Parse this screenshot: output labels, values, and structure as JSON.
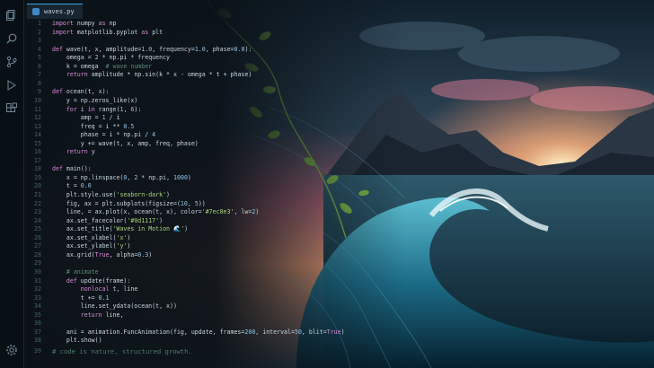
{
  "editor": {
    "tab_label": "waves.py",
    "lines": [
      {
        "n": "1",
        "text": "import numpy as np"
      },
      {
        "n": "2",
        "text": "import matplotlib.pyplot as plt"
      },
      {
        "n": "3",
        "text": ""
      },
      {
        "n": "4",
        "text": "def wave(t, x, amplitude=1.0, frequency=1.0, phase=0.0):"
      },
      {
        "n": "5",
        "text": "    omega = 2 * np.pi * frequency"
      },
      {
        "n": "6",
        "text": "    k = omega  # wave number"
      },
      {
        "n": "7",
        "text": "    return amplitude * np.sin(k * x - omega * t + phase)"
      },
      {
        "n": "8",
        "text": ""
      },
      {
        "n": "9",
        "text": "def ocean(t, x):"
      },
      {
        "n": "10",
        "text": "    y = np.zeros_like(x)"
      },
      {
        "n": "11",
        "text": "    for i in range(1, 6):"
      },
      {
        "n": "12",
        "text": "        amp = 1 / i"
      },
      {
        "n": "13",
        "text": "        freq = i ** 0.5"
      },
      {
        "n": "14",
        "text": "        phase = i * np.pi / 4"
      },
      {
        "n": "15",
        "text": "        y += wave(t, x, amp, freq, phase)"
      },
      {
        "n": "16",
        "text": "    return y"
      },
      {
        "n": "17",
        "text": ""
      },
      {
        "n": "18",
        "text": "def main():"
      },
      {
        "n": "19",
        "text": "    x = np.linspace(0, 2 * np.pi, 1000)"
      },
      {
        "n": "20",
        "text": "    t = 0.0"
      },
      {
        "n": "21",
        "text": "    plt.style.use('seaborn-dark')"
      },
      {
        "n": "22",
        "text": "    fig, ax = plt.subplots(figsize=(10, 5))"
      },
      {
        "n": "23",
        "text": "    line, = ax.plot(x, ocean(t, x), color='#7ec8e3', lw=2)"
      },
      {
        "n": "24",
        "text": "    ax.set_facecolor('#0d1117')"
      },
      {
        "n": "25",
        "text": "    ax.set_title('Waves in Motion 🌊')"
      },
      {
        "n": "26",
        "text": "    ax.set_xlabel('x')"
      },
      {
        "n": "27",
        "text": "    ax.set_ylabel('y')"
      },
      {
        "n": "28",
        "text": "    ax.grid(True, alpha=0.3)"
      },
      {
        "n": "29",
        "text": ""
      },
      {
        "n": "30",
        "text": "    # animate"
      },
      {
        "n": "31",
        "text": "    def update(frame):"
      },
      {
        "n": "32",
        "text": "        nonlocal t, line"
      },
      {
        "n": "33",
        "text": "        t += 0.1"
      },
      {
        "n": "34",
        "text": "        line.set_ydata(ocean(t, x))"
      },
      {
        "n": "35",
        "text": "        return line,"
      },
      {
        "n": "36",
        "text": ""
      },
      {
        "n": "37",
        "text": "    ani = animation.FuncAnimation(fig, update, frames=200, interval=50, blit=True)"
      },
      {
        "n": "38",
        "text": "    plt.show()"
      }
    ],
    "footer_line_number": "39",
    "footer_comment": "# code is nature, structured growth."
  },
  "activity_bar": {
    "icons": [
      "files-icon",
      "search-icon",
      "source-control-icon",
      "run-debug-icon",
      "extensions-icon",
      "settings-gear-icon"
    ]
  },
  "colors": {
    "keyword": "#d98bd6",
    "function": "#e8c77a",
    "string": "#a8d47c",
    "number": "#8fc7ef",
    "comment": "#5f8c78",
    "plain": "#c9d6df",
    "accent": "#3fa2d8"
  }
}
